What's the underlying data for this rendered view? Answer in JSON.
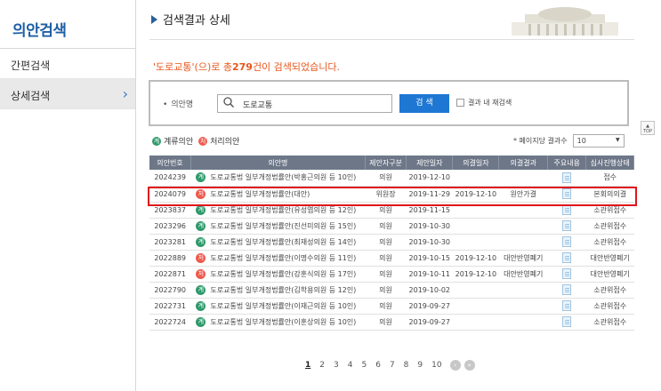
{
  "sidebar": {
    "title": "의안검색",
    "items": [
      {
        "label": "간편검색"
      },
      {
        "label": "상세검색",
        "chevron": "›"
      }
    ]
  },
  "header": {
    "title": "검색결과 상세"
  },
  "summary": {
    "prefix": "'도로교통'(으)로 총",
    "count": "279",
    "suffix": "건이 검색되었습니다."
  },
  "search": {
    "label": "의안명",
    "value": "도로교통",
    "button": "검 색",
    "within_label": "결과 내 재검색"
  },
  "top_button": {
    "arrow": "▲",
    "label": "TOP"
  },
  "legend": {
    "pending": {
      "mark": "계",
      "label": "계류의안"
    },
    "processed": {
      "mark": "처",
      "label": "처리의안"
    }
  },
  "per_page": {
    "label": "* 페이지당 결과수",
    "value": "10",
    "arrow": "▼"
  },
  "table": {
    "headers": [
      "의안번호",
      "의안명",
      "제안자구분",
      "제안일자",
      "의결일자",
      "의결결과",
      "주요내용",
      "심사진행상태"
    ],
    "rows": [
      {
        "no": "2024239",
        "type": "계",
        "name": "도로교통법 일부개정법률안(박홍근의원 등 10인)",
        "proposer": "의원",
        "date": "2019-12-10",
        "decided": "",
        "result": "",
        "status": "접수"
      },
      {
        "no": "2024079",
        "type": "처",
        "name": "도로교통법 일부개정법률안(대안)",
        "proposer": "위원장",
        "date": "2019-11-29",
        "decided": "2019-12-10",
        "result": "원안가결",
        "status": "본회의의결"
      },
      {
        "no": "2023837",
        "type": "계",
        "name": "도로교통법 일부개정법률안(유성엽의원 등 12인)",
        "proposer": "의원",
        "date": "2019-11-15",
        "decided": "",
        "result": "",
        "status": "소관위접수"
      },
      {
        "no": "2023296",
        "type": "계",
        "name": "도로교통법 일부개정법률안(진선미의원 등 15인)",
        "proposer": "의원",
        "date": "2019-10-30",
        "decided": "",
        "result": "",
        "status": "소관위접수"
      },
      {
        "no": "2023281",
        "type": "계",
        "name": "도로교통법 일부개정법률안(최재성의원 등 14인)",
        "proposer": "의원",
        "date": "2019-10-30",
        "decided": "",
        "result": "",
        "status": "소관위접수"
      },
      {
        "no": "2022889",
        "type": "처",
        "name": "도로교통법 일부개정법률안(이명수의원 등 11인)",
        "proposer": "의원",
        "date": "2019-10-15",
        "decided": "2019-12-10",
        "result": "대안반영폐기",
        "status": "대안반영폐기"
      },
      {
        "no": "2022871",
        "type": "처",
        "name": "도로교통법 일부개정법률안(강훈식의원 등 17인)",
        "proposer": "의원",
        "date": "2019-10-11",
        "decided": "2019-12-10",
        "result": "대안반영폐기",
        "status": "대안반영폐기"
      },
      {
        "no": "2022790",
        "type": "계",
        "name": "도로교통법 일부개정법률안(김학용의원 등 12인)",
        "proposer": "의원",
        "date": "2019-10-02",
        "decided": "",
        "result": "",
        "status": "소관위접수"
      },
      {
        "no": "2022731",
        "type": "계",
        "name": "도로교통법 일부개정법률안(이재근의원 등 10인)",
        "proposer": "의원",
        "date": "2019-09-27",
        "decided": "",
        "result": "",
        "status": "소관위접수"
      },
      {
        "no": "2022724",
        "type": "계",
        "name": "도로교통법 일부개정법률안(이훈상의원 등 10인)",
        "proposer": "의원",
        "date": "2019-09-27",
        "decided": "",
        "result": "",
        "status": "소관위접수"
      }
    ]
  },
  "pagination": {
    "pages": [
      "1",
      "2",
      "3",
      "4",
      "5",
      "6",
      "7",
      "8",
      "9",
      "10"
    ],
    "current": "1",
    "next": "›",
    "last": "»"
  },
  "colors": {
    "accent": "#1e77d3",
    "highlight": "#e0141d",
    "summary": "#e8561c",
    "pending": "#2f9a6b",
    "processed": "#ee5a4f"
  }
}
